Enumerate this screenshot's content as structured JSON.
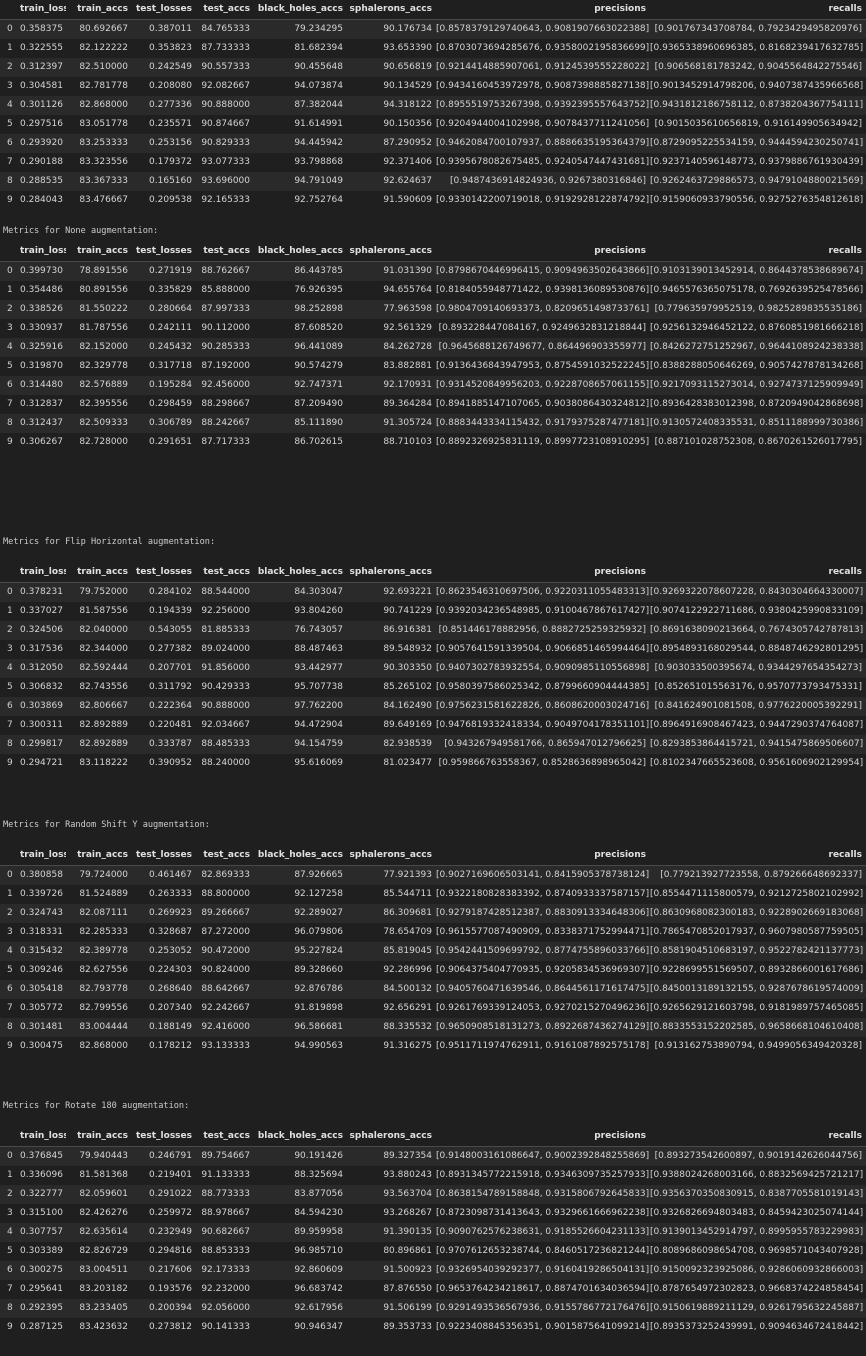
{
  "columns": [
    "train_losses",
    "train_accs",
    "test_losses",
    "test_accs",
    "black_holes_accs",
    "sphalerons_accs",
    "precisions",
    "recalls"
  ],
  "sections": [
    {
      "heading": "",
      "rows": [
        [
          "0",
          "0.358375",
          "80.692667",
          "0.387011",
          "84.765333",
          "79.234295",
          "90.176734",
          "[0.8578379129740643, 0.9081907663022388]",
          "[0.901767343708784, 0.7923429495820976]"
        ],
        [
          "1",
          "0.322555",
          "82.122222",
          "0.353823",
          "87.733333",
          "81.682394",
          "93.653390",
          "[0.8703073694285676, 0.9358002195836699]",
          "[0.9365338960696385, 0.8168239417632785]"
        ],
        [
          "2",
          "0.312397",
          "82.510000",
          "0.242549",
          "90.557333",
          "90.455648",
          "90.656819",
          "[0.9214414885907061, 0.9124539555228022]",
          "[0.906568181783242, 0.9045564842275546]"
        ],
        [
          "3",
          "0.304581",
          "82.781778",
          "0.208080",
          "92.082667",
          "94.073874",
          "90.134529",
          "[0.9434160453972978, 0.9087398885827138]",
          "[0.9013452914798206, 0.9407387435966568]"
        ],
        [
          "4",
          "0.301126",
          "82.868000",
          "0.277336",
          "90.888000",
          "87.382044",
          "94.318122",
          "[0.8955519753267398, 0.9392395557643752]",
          "[0.9431812186758112, 0.8738204367754111]"
        ],
        [
          "5",
          "0.297516",
          "83.051778",
          "0.235571",
          "90.874667",
          "91.614991",
          "90.150356",
          "[0.9204944004102998, 0.9078437711241056]",
          "[0.9015035610656819, 0.916149905634942]"
        ],
        [
          "6",
          "0.293920",
          "83.253333",
          "0.253156",
          "90.829333",
          "94.445942",
          "87.290952",
          "[0.9462084700107937, 0.8886635195364379]",
          "[0.8729095225534159, 0.9444594230250741]"
        ],
        [
          "7",
          "0.290188",
          "83.323556",
          "0.179372",
          "93.077333",
          "93.798868",
          "92.371406",
          "[0.9395678082675485, 0.9240547447431681]",
          "[0.9237140596148773, 0.9379886761930439]"
        ],
        [
          "8",
          "0.288535",
          "83.367333",
          "0.165160",
          "93.696000",
          "94.791049",
          "92.624637",
          "[0.9487436914824936, 0.9267380316846]",
          "[0.9262463729886573, 0.9479104880021569]"
        ],
        [
          "9",
          "0.284043",
          "83.476667",
          "0.209538",
          "92.165333",
          "92.752764",
          "91.590609",
          "[0.9330142200719018, 0.9192928122874792]",
          "[0.9159060933790556, 0.9275276354812618]"
        ]
      ]
    },
    {
      "heading": "Metrics for None augmentation:",
      "rows": [
        [
          "0",
          "0.399730",
          "78.891556",
          "0.271919",
          "88.762667",
          "86.443785",
          "91.031390",
          "[0.8798670446996415, 0.9094963502643866]",
          "[0.9103139013452914, 0.8644378538689674]"
        ],
        [
          "1",
          "0.354486",
          "80.891556",
          "0.335829",
          "85.888000",
          "76.926395",
          "94.655764",
          "[0.8184055948771422, 0.9398136089530876]",
          "[0.9465576365075178, 0.7692639525478566]"
        ],
        [
          "2",
          "0.338526",
          "81.550222",
          "0.280664",
          "87.997333",
          "98.252898",
          "77.963598",
          "[0.9804709140693373, 0.8209651498733761]",
          "[0.779635979952519, 0.9825289835535186]"
        ],
        [
          "3",
          "0.330937",
          "81.787556",
          "0.242111",
          "90.112000",
          "87.608520",
          "92.561329",
          "[0.893228447084167, 0.9249632831218844]",
          "[0.9256132946452122, 0.8760851981666218]"
        ],
        [
          "4",
          "0.325916",
          "82.152000",
          "0.245432",
          "90.285333",
          "96.441089",
          "84.262728",
          "[0.9645688126749677, 0.864496903355977]",
          "[0.8426272751252967, 0.9644108924238338]"
        ],
        [
          "5",
          "0.319870",
          "82.329778",
          "0.317718",
          "87.192000",
          "90.574279",
          "83.882881",
          "[0.9136436843947953, 0.8754591032522245]",
          "[0.8388288050646269, 0.9057427878134268]"
        ],
        [
          "6",
          "0.314480",
          "82.576889",
          "0.195284",
          "92.456000",
          "92.747371",
          "92.170931",
          "[0.9314520849956203, 0.9228708657061155]",
          "[0.9217093115273014, 0.9274737125909949]"
        ],
        [
          "7",
          "0.312837",
          "82.395556",
          "0.298459",
          "88.298667",
          "87.209490",
          "89.364284",
          "[0.8941885147107065, 0.9038086430324812]",
          "[0.8936428383012398, 0.8720949042868698]"
        ],
        [
          "8",
          "0.312437",
          "82.509333",
          "0.306789",
          "88.242667",
          "85.111890",
          "91.305724",
          "[0.8883443334115432, 0.9179375287477181]",
          "[0.9130572408335531, 0.8511188999730386]"
        ],
        [
          "9",
          "0.306267",
          "82.728000",
          "0.291651",
          "87.717333",
          "86.702615",
          "88.710103",
          "[0.8892326925831119, 0.8997723108910295]",
          "[0.887101028752308, 0.8670261526017795]"
        ]
      ]
    },
    {
      "heading": "Metrics for Flip Horizontal augmentation:",
      "rows": [
        [
          "0",
          "0.378231",
          "79.752000",
          "0.284102",
          "88.544000",
          "84.303047",
          "92.693221",
          "[0.8623546310697506, 0.9220311055483313]",
          "[0.9269322078607228, 0.8430304664330007]"
        ],
        [
          "1",
          "0.337027",
          "81.587556",
          "0.194339",
          "92.256000",
          "93.804260",
          "90.741229",
          "[0.9392034236548985, 0.9100467867617427]",
          "[0.9074122922711686, 0.9380425990833109]"
        ],
        [
          "2",
          "0.324506",
          "82.040000",
          "0.543055",
          "81.885333",
          "76.743057",
          "86.916381",
          "[0.851446178882956, 0.8882725259325932]",
          "[0.8691638090213664, 0.7674305742787813]"
        ],
        [
          "3",
          "0.317536",
          "82.344000",
          "0.277382",
          "89.024000",
          "88.487463",
          "89.548932",
          "[0.9057641591339504, 0.9066851465994464]",
          "[0.8954893168029544, 0.8848746292801295]"
        ],
        [
          "4",
          "0.312050",
          "82.592444",
          "0.207701",
          "91.856000",
          "93.442977",
          "90.303350",
          "[0.9407302783932554, 0.9090985110556898]",
          "[0.903033500395674, 0.9344297654354273]"
        ],
        [
          "5",
          "0.306832",
          "82.743556",
          "0.311792",
          "90.429333",
          "95.707738",
          "85.265102",
          "[0.9580397586025342, 0.8799660904444385]",
          "[0.852651015563176, 0.9570773793475331]"
        ],
        [
          "6",
          "0.303869",
          "82.806667",
          "0.222364",
          "90.888000",
          "97.762200",
          "84.162490",
          "[0.9756231581622826, 0.8608620003024716]",
          "[0.841624901081508, 0.9776220005392291]"
        ],
        [
          "7",
          "0.300311",
          "82.892889",
          "0.220481",
          "92.034667",
          "94.472904",
          "89.649169",
          "[0.9476819332418334, 0.9049704178351101]",
          "[0.8964916908467423, 0.9447290374764087]"
        ],
        [
          "8",
          "0.299817",
          "82.892889",
          "0.333787",
          "88.485333",
          "94.154759",
          "82.938539",
          "[0.943267949581766, 0.865947012796625]",
          "[0.8293853864415721, 0.9415475869506607]"
        ],
        [
          "9",
          "0.294721",
          "83.118222",
          "0.390952",
          "88.240000",
          "95.616069",
          "81.023477",
          "[0.959866763558367, 0.8528636898965042]",
          "[0.8102347665523608, 0.9561606902129954]"
        ]
      ]
    },
    {
      "heading": "Metrics for Random Shift Y augmentation:",
      "rows": [
        [
          "0",
          "0.380858",
          "79.724000",
          "0.461467",
          "82.869333",
          "87.926665",
          "77.921393",
          "[0.9027169606503141, 0.8415905378738124]",
          "[0.779213927723558, 0.879266648692337]"
        ],
        [
          "1",
          "0.339726",
          "81.524889",
          "0.263333",
          "88.800000",
          "92.127258",
          "85.544711",
          "[0.9322180828383392, 0.8740933337587157]",
          "[0.8554471115800579, 0.9212725802102992]"
        ],
        [
          "2",
          "0.324743",
          "82.087111",
          "0.269923",
          "89.266667",
          "92.289027",
          "86.309681",
          "[0.9279187428512387, 0.8830913334648306]",
          "[0.8630968082300183, 0.9228902669183068]"
        ],
        [
          "3",
          "0.318331",
          "82.285333",
          "0.328687",
          "87.272000",
          "96.079806",
          "78.654709",
          "[0.9615577087490909, 0.8338371752994471]",
          "[0.7865470852017937, 0.9607980587759505]"
        ],
        [
          "4",
          "0.315432",
          "82.389778",
          "0.253052",
          "90.472000",
          "95.227824",
          "85.819045",
          "[0.9542441509699792, 0.8774755896033766]",
          "[0.8581904510683197, 0.9522782421137773]"
        ],
        [
          "5",
          "0.309246",
          "82.627556",
          "0.224303",
          "90.824000",
          "89.328660",
          "92.286996",
          "[0.9064375404770935, 0.9205834536969307]",
          "[0.9228699551569507, 0.8932866001617686]"
        ],
        [
          "6",
          "0.305418",
          "82.793778",
          "0.268640",
          "88.642667",
          "92.876786",
          "84.500132",
          "[0.9405760471639546, 0.8644561171617475]",
          "[0.8450013189132155, 0.9287678619574009]"
        ],
        [
          "7",
          "0.305772",
          "82.799556",
          "0.207340",
          "92.242667",
          "91.819898",
          "92.656291",
          "[0.9261769339124053, 0.9270215270496236]",
          "[0.9265629121603798, 0.9181989757465085]"
        ],
        [
          "8",
          "0.301481",
          "83.004444",
          "0.188149",
          "92.416000",
          "96.586681",
          "88.335532",
          "[0.9650908518131273, 0.8922687436274129]",
          "[0.8833553152202585, 0.9658668104610408]"
        ],
        [
          "9",
          "0.300475",
          "82.868000",
          "0.178212",
          "93.133333",
          "94.990563",
          "91.316275",
          "[0.9511711974762911, 0.9161087892575178]",
          "[0.913162753890794, 0.9499056349420328]"
        ]
      ]
    },
    {
      "heading": "Metrics for Rotate 180 augmentation:",
      "rows": [
        [
          "0",
          "0.376845",
          "79.940443",
          "0.246791",
          "89.754667",
          "90.191426",
          "89.327354",
          "[0.9148003161086647, 0.9002392848255869]",
          "[0.893273542600897, 0.9019142626044756]"
        ],
        [
          "1",
          "0.336096",
          "81.581368",
          "0.219401",
          "91.133333",
          "88.325694",
          "93.880243",
          "[0.8931345772215918, 0.9346309735257933]",
          "[0.9388024268003166, 0.8832569425721217]"
        ],
        [
          "2",
          "0.322777",
          "82.059601",
          "0.291022",
          "88.773333",
          "83.877056",
          "93.563704",
          "[0.8638154789158848, 0.9315806792645833]",
          "[0.9356370350830915, 0.8387705581019143]"
        ],
        [
          "3",
          "0.315100",
          "82.426276",
          "0.259972",
          "88.978667",
          "84.594230",
          "93.268267",
          "[0.8723098731413643, 0.9329661666962238]",
          "[0.9326826694803483, 0.8459423025074144]"
        ],
        [
          "4",
          "0.307757",
          "82.635614",
          "0.232949",
          "90.682667",
          "89.959958",
          "91.390135",
          "[0.9090762576238631, 0.9185526604231133]",
          "[0.9139013452914797, 0.8995955783229983]"
        ],
        [
          "5",
          "0.303389",
          "82.826729",
          "0.294816",
          "88.853333",
          "96.985710",
          "80.896861",
          "[0.9707612653238744, 0.8460517236821244]",
          "[0.8089686098654708, 0.9698571043407928]"
        ],
        [
          "6",
          "0.300275",
          "83.004511",
          "0.217606",
          "92.173333",
          "92.860609",
          "91.500923",
          "[0.9326954039292377, 0.9160419286504131]",
          "[0.9150092323925086, 0.9286060932866003]"
        ],
        [
          "7",
          "0.295641",
          "83.203182",
          "0.193576",
          "92.232000",
          "96.683742",
          "87.876550",
          "[0.9653764234218617, 0.8874701634036594]",
          "[0.8787654972302823, 0.9668374224858454]"
        ],
        [
          "8",
          "0.292395",
          "83.233405",
          "0.200394",
          "92.056000",
          "92.617956",
          "91.506199",
          "[0.9291493536567936, 0.9155786772176476]",
          "[0.9150619889211129, 0.9261795632245887]"
        ],
        [
          "9",
          "0.287125",
          "83.423632",
          "0.273812",
          "90.141333",
          "90.946347",
          "89.353733",
          "[0.9223408845356351, 0.9015875641099214]",
          "[0.8935373252439991, 0.9094634672418442]"
        ]
      ]
    }
  ]
}
